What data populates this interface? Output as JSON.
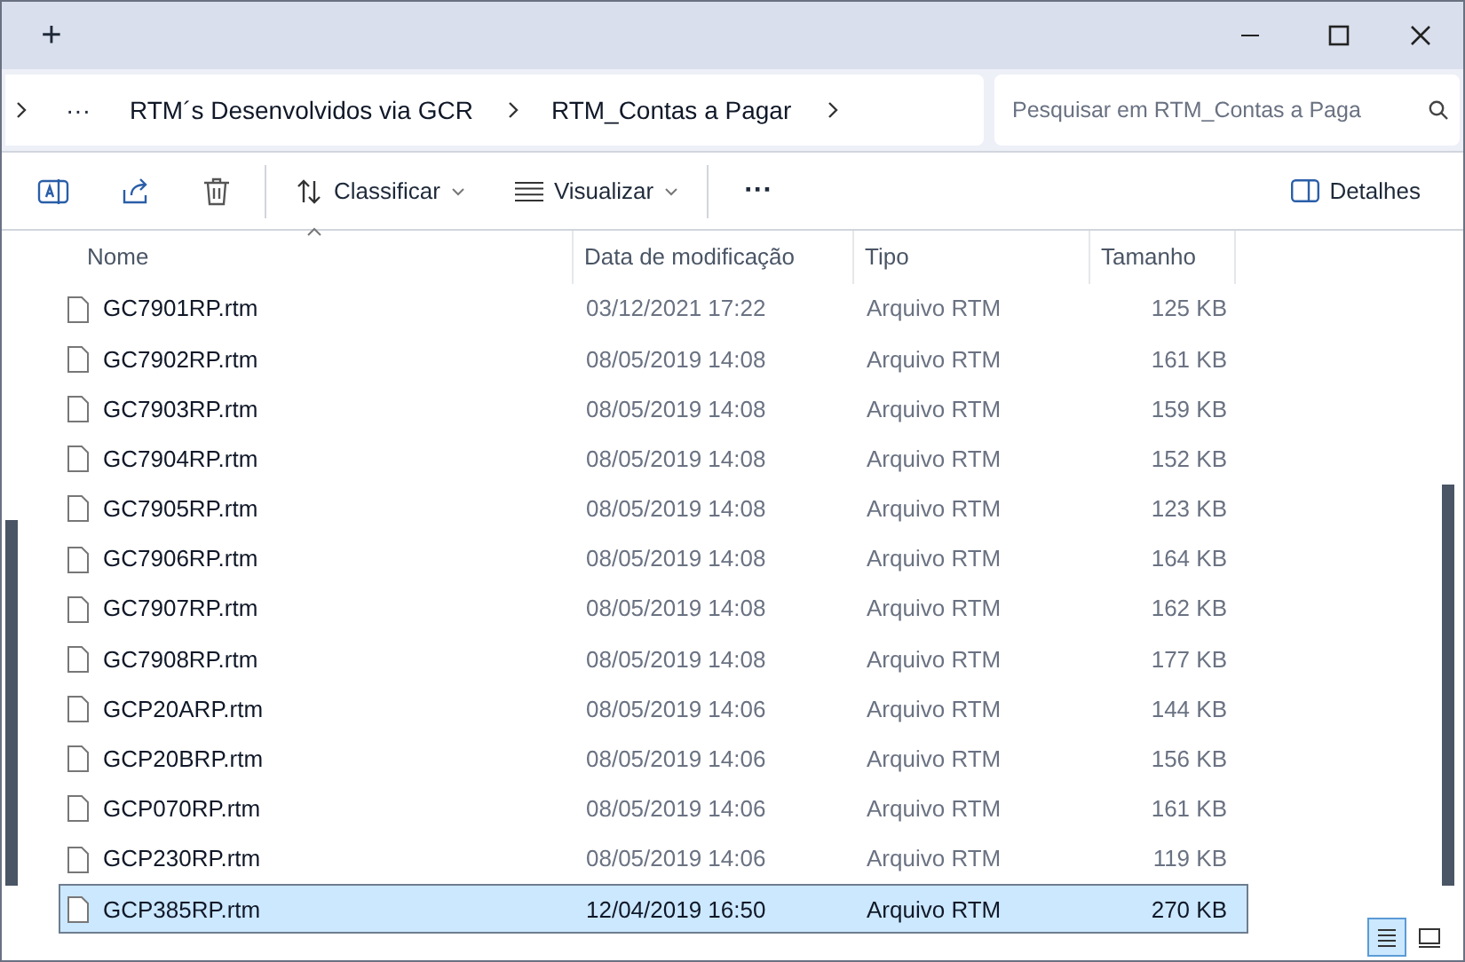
{
  "title_bar": {
    "new_tab": "+"
  },
  "address_bar": {
    "more": "···",
    "breadcrumbs": [
      "RTM´s Desenvolvidos via GCR",
      "RTM_Contas a Pagar"
    ],
    "search": {
      "placeholder": "Pesquisar em RTM_Contas a Paga"
    }
  },
  "toolbar": {
    "sort": "Classificar",
    "view": "Visualizar",
    "more": "···",
    "details": "Detalhes"
  },
  "table": {
    "columns": [
      "Nome",
      "Data de modificação",
      "Tipo",
      "Tamanho"
    ],
    "rows": [
      {
        "name": "GC7901RP.rtm",
        "date": "03/12/2021 17:22",
        "type": "Arquivo RTM",
        "size": "125 KB",
        "selected": false
      },
      {
        "name": "GC7902RP.rtm",
        "date": "08/05/2019 14:08",
        "type": "Arquivo RTM",
        "size": "161 KB",
        "selected": false
      },
      {
        "name": "GC7903RP.rtm",
        "date": "08/05/2019 14:08",
        "type": "Arquivo RTM",
        "size": "159 KB",
        "selected": false
      },
      {
        "name": "GC7904RP.rtm",
        "date": "08/05/2019 14:08",
        "type": "Arquivo RTM",
        "size": "152 KB",
        "selected": false
      },
      {
        "name": "GC7905RP.rtm",
        "date": "08/05/2019 14:08",
        "type": "Arquivo RTM",
        "size": "123 KB",
        "selected": false
      },
      {
        "name": "GC7906RP.rtm",
        "date": "08/05/2019 14:08",
        "type": "Arquivo RTM",
        "size": "164 KB",
        "selected": false
      },
      {
        "name": "GC7907RP.rtm",
        "date": "08/05/2019 14:08",
        "type": "Arquivo RTM",
        "size": "162 KB",
        "selected": false
      },
      {
        "name": "GC7908RP.rtm",
        "date": "08/05/2019 14:08",
        "type": "Arquivo RTM",
        "size": "177 KB",
        "selected": false
      },
      {
        "name": "GCP20ARP.rtm",
        "date": "08/05/2019 14:06",
        "type": "Arquivo RTM",
        "size": "144 KB",
        "selected": false
      },
      {
        "name": "GCP20BRP.rtm",
        "date": "08/05/2019 14:06",
        "type": "Arquivo RTM",
        "size": "156 KB",
        "selected": false
      },
      {
        "name": "GCP070RP.rtm",
        "date": "08/05/2019 14:06",
        "type": "Arquivo RTM",
        "size": "161 KB",
        "selected": false
      },
      {
        "name": "GCP230RP.rtm",
        "date": "08/05/2019 14:06",
        "type": "Arquivo RTM",
        "size": "119 KB",
        "selected": false
      },
      {
        "name": "GCP385RP.rtm",
        "date": "12/04/2019 16:50",
        "type": "Arquivo RTM",
        "size": "270 KB",
        "selected": true
      }
    ]
  },
  "view_toggle": [
    {
      "kind": "details",
      "selected": true
    },
    {
      "kind": "tiles",
      "selected": false
    }
  ]
}
